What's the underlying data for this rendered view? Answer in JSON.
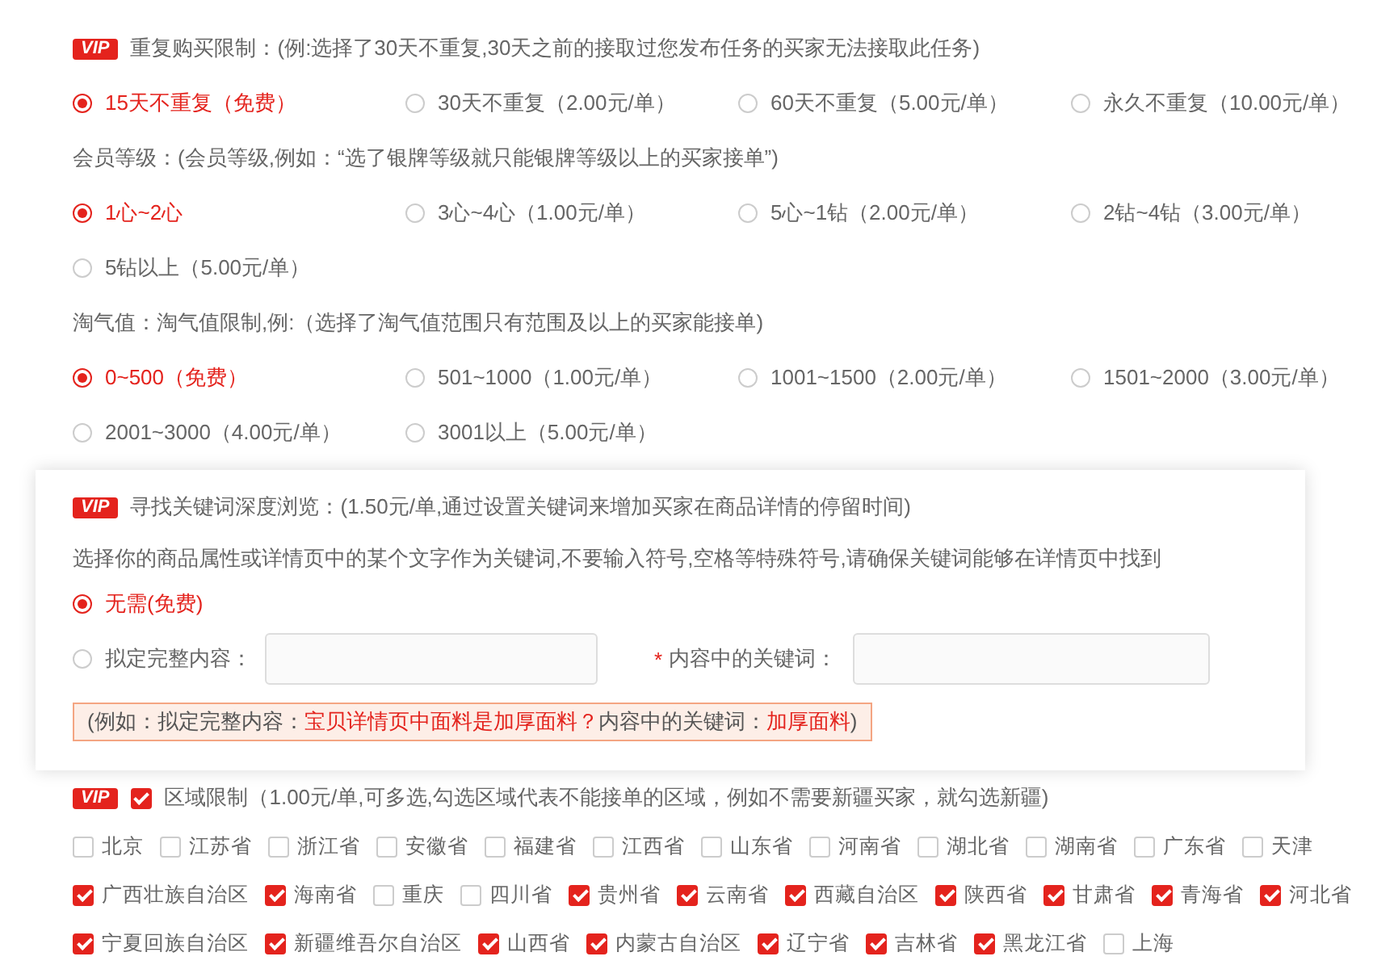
{
  "sections": [
    {
      "kind": "radio",
      "badge": "VIP",
      "title": "重复购买限制：(例:选择了30天不重复,30天之前的接取过您发布任务的买家无法接取此任务)",
      "options": [
        {
          "label": "15天不重复（免费）",
          "selected": true
        },
        {
          "label": "30天不重复（2.00元/单）",
          "selected": false
        },
        {
          "label": "60天不重复（5.00元/单）",
          "selected": false
        },
        {
          "label": "永久不重复（10.00元/单）",
          "selected": false
        }
      ]
    },
    {
      "kind": "radio",
      "title": "会员等级：(会员等级,例如：“选了银牌等级就只能银牌等级以上的买家接单”)",
      "options": [
        {
          "label": "1心~2心",
          "selected": true
        },
        {
          "label": "3心~4心（1.00元/单）",
          "selected": false
        },
        {
          "label": "5心~1钻（2.00元/单）",
          "selected": false
        },
        {
          "label": "2钻~4钻（3.00元/单）",
          "selected": false
        },
        {
          "label": "5钻以上（5.00元/单）",
          "selected": false
        }
      ]
    },
    {
      "kind": "radio",
      "title": "淘气值：淘气值限制,例:（选择了淘气值范围只有范围及以上的买家能接单)",
      "options": [
        {
          "label": "0~500（免费）",
          "selected": true
        },
        {
          "label": "501~1000（1.00元/单）",
          "selected": false
        },
        {
          "label": "1001~1500（2.00元/单）",
          "selected": false
        },
        {
          "label": "1501~2000（3.00元/单）",
          "selected": false
        },
        {
          "label": "2001~3000（4.00元/单）",
          "selected": false
        },
        {
          "label": "3001以上（5.00元/单）",
          "selected": false
        }
      ]
    },
    {
      "kind": "keyword",
      "badge": "VIP",
      "title": "寻找关键词深度浏览：(1.50元/单,通过设置关键词来增加买家在商品详情的停留时间)",
      "description": "选择你的商品属性或详情页中的某个文字作为关键词,不要输入符号,空格等特殊符号,请确保关键词能够在详情页中找到",
      "options": [
        {
          "label": "无需(免费)",
          "selected": true
        },
        {
          "label": "拟定完整内容：",
          "selected": false
        }
      ],
      "keyword_label": "内容中的关键词：",
      "required_mark": "*",
      "example": [
        {
          "text": "(例如：拟定完整内容：",
          "highlight": false
        },
        {
          "text": "宝贝详情页中面料是加厚面料？",
          "highlight": true
        },
        {
          "text": "内容中的关键词：",
          "highlight": false
        },
        {
          "text": "加厚面料",
          "highlight": true
        },
        {
          "text": ")",
          "highlight": false
        }
      ]
    },
    {
      "kind": "region",
      "badge": "VIP",
      "checked": true,
      "title": "区域限制（1.00元/单,可多选,勾选区域代表不能接单的区域，例如不需要新疆买家，就勾选新疆)",
      "provinces": [
        {
          "name": "北京",
          "checked": false
        },
        {
          "name": "江苏省",
          "checked": false
        },
        {
          "name": "浙江省",
          "checked": false
        },
        {
          "name": "安徽省",
          "checked": false
        },
        {
          "name": "福建省",
          "checked": false
        },
        {
          "name": "江西省",
          "checked": false
        },
        {
          "name": "山东省",
          "checked": false
        },
        {
          "name": "河南省",
          "checked": false
        },
        {
          "name": "湖北省",
          "checked": false
        },
        {
          "name": "湖南省",
          "checked": false
        },
        {
          "name": "广东省",
          "checked": false
        },
        {
          "name": "天津",
          "checked": false
        },
        {
          "name": "广西壮族自治区",
          "checked": true
        },
        {
          "name": "海南省",
          "checked": true
        },
        {
          "name": "重庆",
          "checked": false
        },
        {
          "name": "四川省",
          "checked": false
        },
        {
          "name": "贵州省",
          "checked": true
        },
        {
          "name": "云南省",
          "checked": true
        },
        {
          "name": "西藏自治区",
          "checked": true
        },
        {
          "name": "陕西省",
          "checked": true
        },
        {
          "name": "甘肃省",
          "checked": true
        },
        {
          "name": "青海省",
          "checked": true
        },
        {
          "name": "河北省",
          "checked": true
        },
        {
          "name": "宁夏回族自治区",
          "checked": true
        },
        {
          "name": "新疆维吾尔自治区",
          "checked": true
        },
        {
          "name": "山西省",
          "checked": true
        },
        {
          "name": "内蒙古自治区",
          "checked": true
        },
        {
          "name": "辽宁省",
          "checked": true
        },
        {
          "name": "吉林省",
          "checked": true
        },
        {
          "name": "黑龙江省",
          "checked": true
        },
        {
          "name": "上海",
          "checked": false
        }
      ]
    }
  ]
}
